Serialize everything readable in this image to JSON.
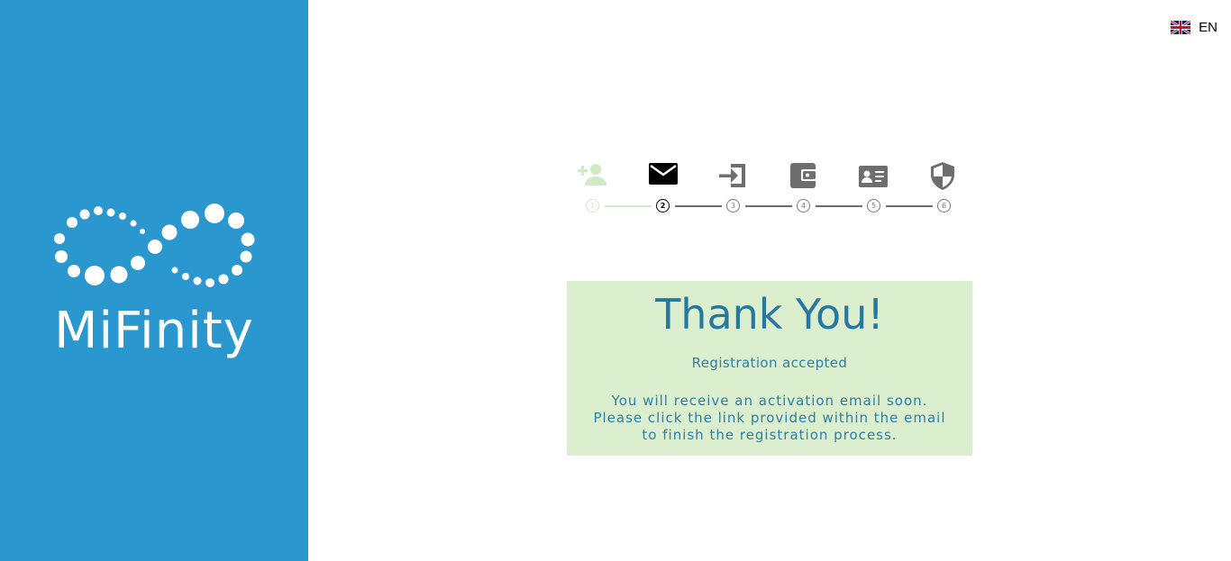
{
  "brand": {
    "name": "MiFinity",
    "color": "#2b97cf"
  },
  "language": {
    "code": "EN",
    "flag_icon": "uk-flag-icon"
  },
  "steps": [
    {
      "number": "1",
      "icon": "person-add-icon",
      "state": "done"
    },
    {
      "number": "2",
      "icon": "mail-icon",
      "state": "active"
    },
    {
      "number": "3",
      "icon": "login-icon",
      "state": "pending"
    },
    {
      "number": "4",
      "icon": "wallet-icon",
      "state": "pending"
    },
    {
      "number": "5",
      "icon": "id-card-icon",
      "state": "pending"
    },
    {
      "number": "6",
      "icon": "shield-icon",
      "state": "pending"
    }
  ],
  "message": {
    "title": "Thank You!",
    "subtitle": "Registration accepted",
    "body_lines": [
      "You will receive an activation email soon.",
      "Please click the link provided within the email",
      "to finish the registration process."
    ],
    "background": "#dbeece",
    "text_color": "#2778a0"
  }
}
